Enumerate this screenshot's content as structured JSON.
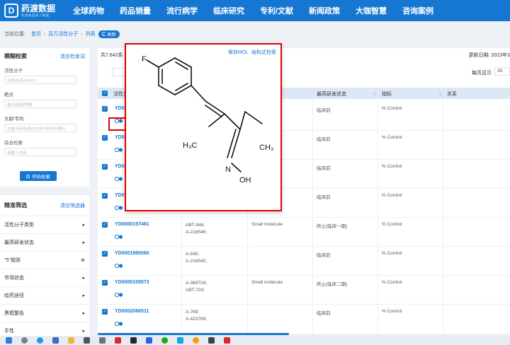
{
  "brand": {
    "name": "药渡数据",
    "tagline": "药渡集团旗下数据"
  },
  "nav": [
    "全球药物",
    "药品销量",
    "流行病学",
    "临床研究",
    "专利/文献",
    "新闻政策",
    "大咖智慧",
    "咨询案例"
  ],
  "breadcrumb": {
    "prefix": "当前位置:",
    "home": "首页",
    "section": "百万活性分子",
    "page": "列表",
    "refresh": "刷新"
  },
  "search_panel": {
    "title": "模糊检索",
    "clear": "清空检索词",
    "fields": [
      {
        "label": "活性分子",
        "placeholder": "名称/别名/ID/ATC"
      },
      {
        "label": "靶点",
        "placeholder": "蛋白/基因/种属"
      },
      {
        "label": "文献/专利",
        "placeholder": "文献/专利标题/DOI号/专利号/期刊"
      },
      {
        "label": "综合检索",
        "placeholder": "请输入内容"
      }
    ],
    "search_button": "开始检索"
  },
  "filter_panel": {
    "title": "精准筛选",
    "clear": "清空筛选器",
    "items": [
      "活性分子类型",
      "最高研发状态",
      "\"5\"规则",
      "市场状态",
      "给药途径",
      "黑框警告",
      "手性"
    ]
  },
  "main": {
    "total": "共7,642条",
    "update_date": "更新日期: 2023年3",
    "tool_button": "",
    "per_page_label": "每页显示",
    "per_page_value": "20"
  },
  "table": {
    "headers": [
      "活性分",
      "最高研发状态",
      "指标",
      "关系"
    ],
    "rows": [
      {
        "id": "YD0",
        "codes": [],
        "type": "ule",
        "status": "临床前",
        "indicator": "% Control"
      },
      {
        "id": "YD0",
        "codes": [],
        "type": "",
        "status": "临床前",
        "indicator": "% Control"
      },
      {
        "id": "YD0",
        "codes": [],
        "type": "",
        "status": "临床前",
        "indicator": "% Control"
      },
      {
        "id": "YD0",
        "codes": [],
        "type": "",
        "status": "临床前",
        "indicator": "% Control"
      },
      {
        "id": "YD0000157461",
        "codes": [
          "ABT-546;",
          "A-216546;"
        ],
        "type": "Small molecule",
        "status": "终止(临床一期)",
        "indicator": "% Control"
      },
      {
        "id": "YD0001985060",
        "codes": [
          "A-545;",
          "A-216545;"
        ],
        "type": "",
        "status": "临床前",
        "indicator": "% Control"
      },
      {
        "id": "YD0000105573",
        "codes": [
          "A-369724;",
          "ABT-724;"
        ],
        "type": "Small molecule",
        "status": "终止(临床二期)",
        "indicator": "% Control"
      },
      {
        "id": "YD0002066511",
        "codes": [
          "A-769;",
          "A-423769;"
        ],
        "type": "",
        "status": "临床前",
        "indicator": "% Control"
      }
    ]
  },
  "popup": {
    "save_mol": "保存MOL",
    "structure_search": "结构式检索",
    "atoms": {
      "f": "F",
      "ch3_left": "H₃C",
      "ch3_right": "CH₃",
      "n": "N",
      "oh": "OH"
    }
  },
  "colors": {
    "brand_blue": "#1677d2",
    "highlight_red": "#e00000",
    "header_bg": "#dde8f6"
  },
  "taskbar_icons": [
    "windows-icon",
    "search-icon",
    "edge-icon",
    "files-icon",
    "folder-icon",
    "app-icon",
    "app-icon",
    "wps-icon",
    "terminal-icon",
    "app-icon",
    "wechat-icon",
    "app-icon",
    "browser-icon",
    "app-icon",
    "wps-icon"
  ]
}
